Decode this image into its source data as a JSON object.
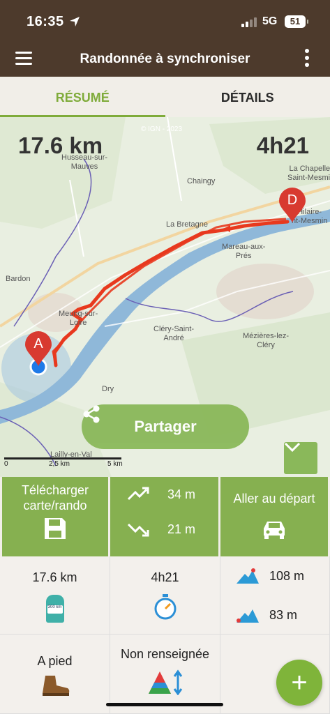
{
  "status_bar": {
    "time": "16:35",
    "network": "5G",
    "battery": "51"
  },
  "app_bar": {
    "title": "Randonnée à synchroniser"
  },
  "tabs": [
    {
      "label": "RÉSUMÉ",
      "active": true
    },
    {
      "label": "DÉTAILS",
      "active": false
    }
  ],
  "map": {
    "distance": "17.6 km",
    "duration": "4h21",
    "copyright": "© IGN - 2023",
    "start_marker": "A",
    "end_marker": "D",
    "places": {
      "husseau": "Husseau-sur-\nMauves",
      "chaingy": "Chaingy",
      "chapelle": "La Chapelle-\nSaint-Mesmin",
      "hilaire": "Hilaire-\nnt-Mesmin",
      "bretagne": "La Bretagne",
      "bardon": "Bardon",
      "mareau": "Mareau-aux-\nPrés",
      "meung": "Meung-sur-\nLoire",
      "clery": "Cléry-Saint-\nAndré",
      "mezieres": "Mézières-lez-\nCléry",
      "dry": "Dry",
      "lailly": "Lailly-en-Val"
    },
    "scale": {
      "zero": "0",
      "mid": "2,5 km",
      "max": "5 km"
    },
    "share_label": "Partager",
    "route_color": "#e8391e",
    "accent": "#8ab85a"
  },
  "actions": {
    "download_label": "Télécharger carte/rando",
    "ascent": "34 m",
    "descent": "21 m",
    "go_start_label": "Aller au départ"
  },
  "stats": {
    "distance": "17.6 km",
    "duration": "4h21",
    "max_alt": "108 m",
    "min_alt": "83 m",
    "activity": "A pied",
    "difficulty": "Non renseignée",
    "marker_badge": "300 km"
  },
  "colors": {
    "brown": "#4d3a2c",
    "green": "#7fab3a",
    "action_green": "#86b050"
  }
}
